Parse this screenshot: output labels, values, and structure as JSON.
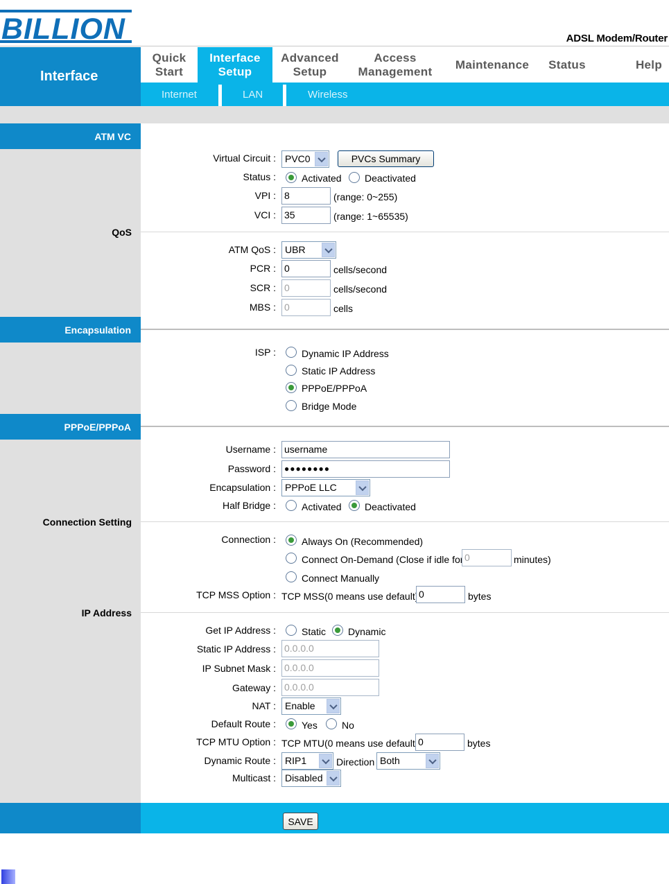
{
  "brand": {
    "logo_text": "BILLION",
    "product": "ADSL Modem/Router"
  },
  "side_title": "Interface",
  "main_menu": [
    {
      "line1": "Quick",
      "line2": "Start"
    },
    {
      "line1": "Interface",
      "line2": "Setup"
    },
    {
      "line1": "Advanced",
      "line2": "Setup"
    },
    {
      "line1": "Access",
      "line2": "Management"
    },
    {
      "line1": "Maintenance",
      "line2": ""
    },
    {
      "line1": "Status",
      "line2": ""
    },
    {
      "line1": "Help",
      "line2": ""
    }
  ],
  "sub_menu": [
    "Internet",
    "LAN",
    "Wireless"
  ],
  "sections": {
    "atm_vc": "ATM VC",
    "qos": "QoS",
    "encapsulation": "Encapsulation",
    "pppoe": "PPPoE/PPPoA",
    "connection_setting": "Connection Setting",
    "ip_address": "IP Address"
  },
  "atm": {
    "virtual_circuit_label": "Virtual Circuit :",
    "virtual_circuit_value": "PVC0",
    "pvcs_summary_button": "PVCs Summary",
    "status_label": "Status :",
    "status_activated": "Activated",
    "status_deactivated": "Deactivated",
    "vpi_label": "VPI :",
    "vpi_value": "8",
    "vpi_range": "(range: 0~255)",
    "vci_label": "VCI :",
    "vci_value": "35",
    "vci_range": "(range: 1~65535)"
  },
  "qos": {
    "atm_qos_label": "ATM QoS :",
    "atm_qos_value": "UBR",
    "pcr_label": "PCR :",
    "pcr_value": "0",
    "pcr_unit": "cells/second",
    "scr_label": "SCR :",
    "scr_value": "0",
    "scr_unit": "cells/second",
    "mbs_label": "MBS :",
    "mbs_value": "0",
    "mbs_unit": "cells"
  },
  "encap": {
    "isp_label": "ISP :",
    "options": [
      "Dynamic IP Address",
      "Static IP Address",
      "PPPoE/PPPoA",
      "Bridge Mode"
    ],
    "selected": "PPPoE/PPPoA"
  },
  "pppoe": {
    "username_label": "Username :",
    "username_value": "username",
    "password_label": "Password :",
    "password_value": "●●●●●●●●",
    "encapsulation_label": "Encapsulation :",
    "encapsulation_value": "PPPoE LLC",
    "half_bridge_label": "Half Bridge :",
    "half_bridge_activated": "Activated",
    "half_bridge_deactivated": "Deactivated"
  },
  "connection": {
    "connection_label": "Connection :",
    "always_on": "Always On (Recommended)",
    "on_demand": "Connect On-Demand (Close if idle for",
    "on_demand_value": "0",
    "on_demand_unit": "minutes)",
    "manually": "Connect Manually",
    "tcp_mss_label": "TCP MSS Option :",
    "tcp_mss_text": "TCP MSS(0 means use default)",
    "tcp_mss_value": "0",
    "tcp_mss_unit": "bytes"
  },
  "ip": {
    "get_ip_label": "Get IP Address :",
    "get_ip_static": "Static",
    "get_ip_dynamic": "Dynamic",
    "static_ip_label": "Static IP Address :",
    "static_ip_value": "0.0.0.0",
    "subnet_label": "IP Subnet Mask :",
    "subnet_value": "0.0.0.0",
    "gateway_label": "Gateway :",
    "gateway_value": "0.0.0.0",
    "nat_label": "NAT :",
    "nat_value": "Enable",
    "default_route_label": "Default Route :",
    "default_route_yes": "Yes",
    "default_route_no": "No",
    "tcp_mtu_label": "TCP MTU Option :",
    "tcp_mtu_text": "TCP MTU(0 means use default)",
    "tcp_mtu_value": "0",
    "tcp_mtu_unit": "bytes",
    "dynamic_route_label": "Dynamic Route :",
    "dynamic_route_value": "RIP1",
    "direction_label": "Direction",
    "direction_value": "Both",
    "multicast_label": "Multicast :",
    "multicast_value": "Disabled"
  },
  "save_button": "SAVE",
  "colors": {
    "dark_blue": "#0f89c9",
    "light_blue": "#0ab4e8",
    "grey": "#e0e0e0"
  }
}
